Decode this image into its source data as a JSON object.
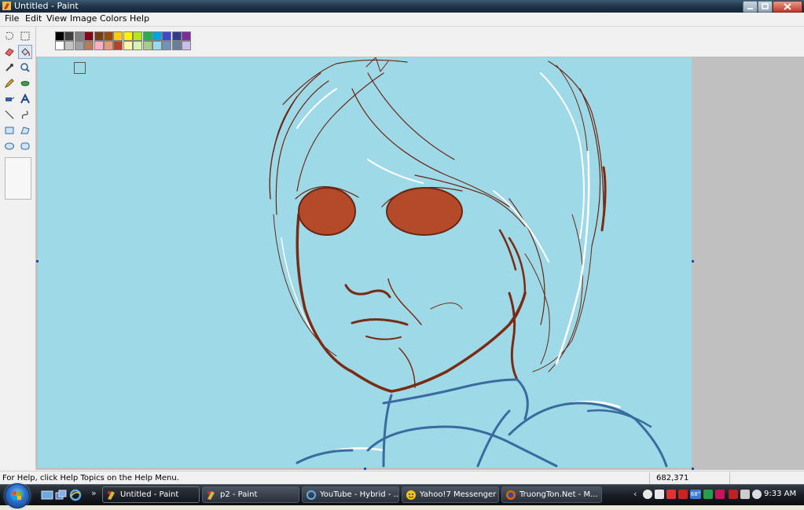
{
  "window": {
    "title": "Untitled - Paint"
  },
  "menu": {
    "items": [
      "File",
      "Edit",
      "View",
      "Image",
      "Colors",
      "Help"
    ]
  },
  "toolbox": {
    "tools": [
      "free-form-select",
      "select",
      "eraser",
      "fill",
      "pick-color",
      "magnifier",
      "pencil",
      "brush",
      "airbrush",
      "text",
      "line",
      "curve",
      "rectangle",
      "polygon",
      "ellipse",
      "rounded-rectangle"
    ],
    "selected": "fill"
  },
  "palette": {
    "foreground": "#9ed9e8",
    "background": "#ffffff",
    "row1": [
      "#000000",
      "#404040",
      "#7f7f7f",
      "#880015",
      "#7a3b19",
      "#9c4a12",
      "#ffc90e",
      "#fff200",
      "#b5e61d",
      "#22b14c",
      "#00a2e8",
      "#3f48cc",
      "#303a8f",
      "#7d2da0"
    ],
    "row2": [
      "#ffffff",
      "#c3c3c3",
      "#a0a0a0",
      "#b97a57",
      "#ffaec9",
      "#e59a7f",
      "#b5442a",
      "#fff7a8",
      "#d7f5b0",
      "#a7cc8d",
      "#99d9ea",
      "#7092be",
      "#6a7f97",
      "#c8bfe7"
    ]
  },
  "canvas": {
    "fill": "#9ed9e8",
    "line_dark": "#7a2b13",
    "line_blue": "#3a6a9e",
    "eye_fill": "#b54a2a"
  },
  "status": {
    "help": "For Help, click Help Topics on the Help Menu.",
    "coords": "682,371"
  },
  "taskbar": {
    "buttons": [
      {
        "label": "Untitled - Paint",
        "icon": "paint-icon",
        "active": true
      },
      {
        "label": "p2 - Paint",
        "icon": "paint-icon",
        "active": false
      },
      {
        "label": "YouTube - Hybrid - ...",
        "icon": "browser-icon",
        "active": false
      },
      {
        "label": "Yahoo!7 Messenger",
        "icon": "messenger-icon",
        "active": false
      },
      {
        "label": "TruongTon.Net - M...",
        "icon": "firefox-icon",
        "active": false
      }
    ],
    "tray_temp": "68°",
    "clock": "9:33 AM"
  }
}
